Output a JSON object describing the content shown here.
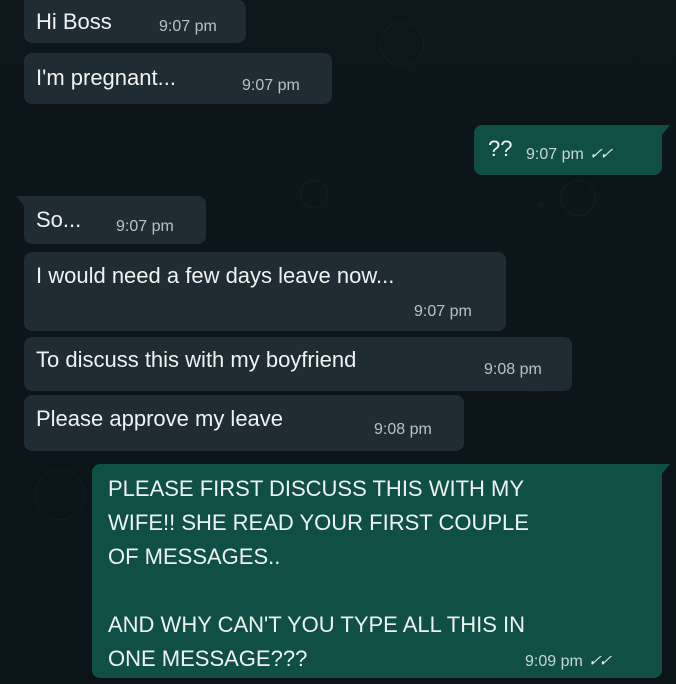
{
  "chat": {
    "messages": [
      {
        "text": "Hi Boss",
        "time": "9:07 pm",
        "direction": "incoming"
      },
      {
        "text": "I'm pregnant...",
        "time": "9:07 pm",
        "direction": "incoming"
      },
      {
        "text": "??",
        "time": "9:07 pm",
        "direction": "outgoing",
        "status": "read"
      },
      {
        "text": "So...",
        "time": "9:07 pm",
        "direction": "incoming"
      },
      {
        "text": "I would need a few days leave now...",
        "time": "9:07 pm",
        "direction": "incoming"
      },
      {
        "text": "To discuss this with my boyfriend",
        "time": "9:08 pm",
        "direction": "incoming"
      },
      {
        "text": "Please approve my leave",
        "time": "9:08 pm",
        "direction": "incoming"
      },
      {
        "text": "PLEASE FIRST DISCUSS THIS WITH MY\nWIFE!! SHE READ YOUR FIRST COUPLE\nOF MESSAGES..\n\nAND WHY CAN'T YOU TYPE ALL THIS IN\nONE MESSAGE???",
        "time": "9:09 pm",
        "direction": "outgoing",
        "status": "read"
      }
    ]
  },
  "icons": {
    "read_receipt": "double-check-icon"
  },
  "colors": {
    "background": "#0b1418",
    "incoming_bubble": "#1f2c33",
    "outgoing_bubble": "#0f4f45",
    "text": "#eef2f3",
    "meta": "#b7c2c6"
  }
}
